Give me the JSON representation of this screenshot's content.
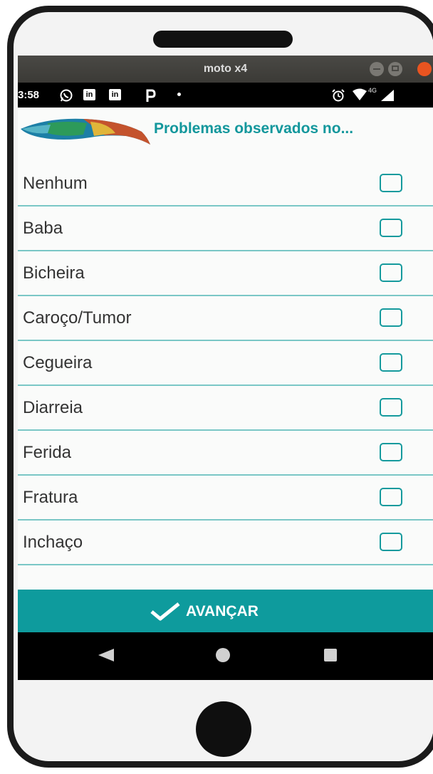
{
  "window": {
    "title": "moto x4"
  },
  "status_bar": {
    "time": "3:58",
    "left_icons": [
      "whatsapp-icon",
      "linkedin-icon",
      "linkedin-icon",
      "pinterest-icon",
      "dot-icon"
    ],
    "right_icons": [
      "alarm-icon",
      "wifi-icon",
      "4g-signal-icon"
    ],
    "network": "4G"
  },
  "header": {
    "title": "Problemas observados no..."
  },
  "options": [
    {
      "label": "Nenhum",
      "checked": false
    },
    {
      "label": "Baba",
      "checked": false
    },
    {
      "label": "Bicheira",
      "checked": false
    },
    {
      "label": "Caroço/Tumor",
      "checked": false
    },
    {
      "label": "Cegueira",
      "checked": false
    },
    {
      "label": "Diarreia",
      "checked": false
    },
    {
      "label": "Ferida",
      "checked": false
    },
    {
      "label": "Fratura",
      "checked": false
    },
    {
      "label": "Inchaço",
      "checked": false
    }
  ],
  "advance_button": {
    "label": "AVANÇAR",
    "icon": "checkmark-icon"
  },
  "colors": {
    "accent": "#0e9b9d",
    "title": "#12979c",
    "divider": "#7ac7c6"
  }
}
